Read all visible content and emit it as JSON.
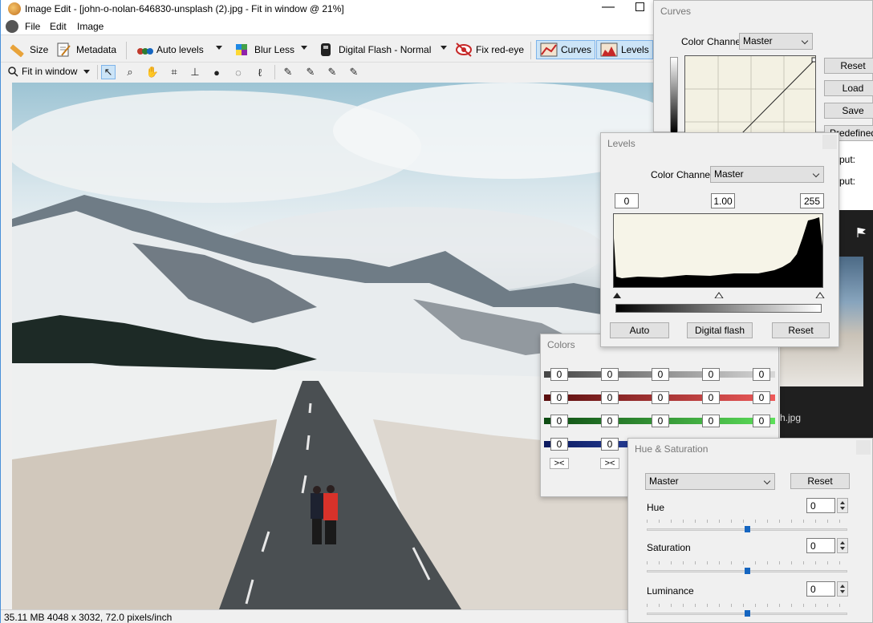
{
  "window": {
    "title": "Image Edit - [john-o-nolan-646830-unsplash (2).jpg - Fit in window @ 21%]"
  },
  "menu": [
    "File",
    "Edit",
    "Image"
  ],
  "toolbar": {
    "size": "Size",
    "metadata": "Metadata",
    "auto_levels": "Auto levels",
    "blur_less": "Blur Less",
    "digital_flash": "Digital Flash - Normal",
    "fix_red_eye": "Fix red-eye",
    "curves": "Curves",
    "levels": "Levels"
  },
  "toolbar2": {
    "zoom": "Fit in window"
  },
  "status": "35.11 MB  4048 x 3032, 72.0 pixels/inch",
  "curves_panel": {
    "title": "Curves",
    "channel_label": "Color Channel:",
    "channel": "Master",
    "buttons": [
      "Reset",
      "Load",
      "Save",
      "Predefined"
    ],
    "input_label": "put:",
    "output_label": "put:"
  },
  "levels_panel": {
    "title": "Levels",
    "channel_label": "Color Channel:",
    "channel": "Master",
    "black": "0",
    "gamma": "1.00",
    "white": "255",
    "buttons": [
      "Auto",
      "Digital flash",
      "Reset"
    ]
  },
  "colors_panel": {
    "title": "Colors",
    "values": [
      "0",
      "0",
      "0",
      "0",
      "0"
    ],
    "swap": "><"
  },
  "huesat_panel": {
    "title": "Hue & Saturation",
    "channel": "Master",
    "reset": "Reset",
    "hue_label": "Hue",
    "hue": "0",
    "saturation_label": "Saturation",
    "saturation": "0",
    "luminance_label": "Luminance",
    "luminance": "0"
  },
  "browser": {
    "file_suffix": "h.jpg"
  },
  "colors": {
    "accent": "#1565c0",
    "toolbar_pressed": "#cce4f7",
    "panel_bg": "#f0f0f0"
  }
}
